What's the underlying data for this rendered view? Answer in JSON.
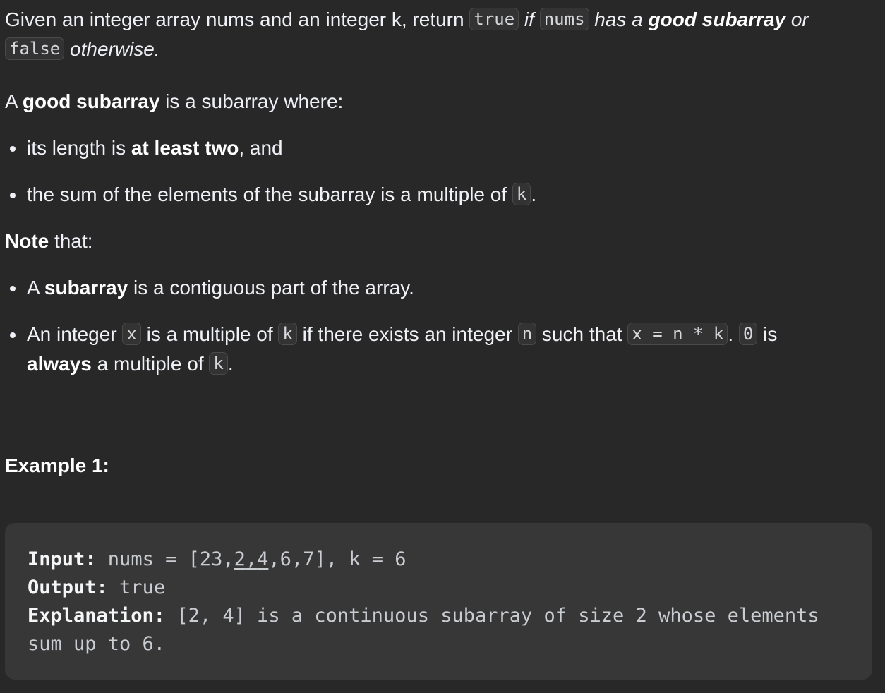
{
  "intro": {
    "t1": "Given an integer array nums and an integer k, return ",
    "code_true": "true",
    "t2": " if ",
    "code_nums": "nums",
    "t3": " has a ",
    "bold_good": "good subarray",
    "t4": " or",
    "code_false": "false",
    "t5": " otherwise."
  },
  "definition": {
    "t1": "A ",
    "bold": "good subarray",
    "t2": " is a subarray where:"
  },
  "conditions": [
    {
      "pre": "its length is ",
      "bold": "at least two",
      "post": ", and"
    },
    {
      "pre": "the sum of the elements of the subarray is a multiple of ",
      "code": "k",
      "post": "."
    }
  ],
  "note": {
    "bold": "Note",
    "rest": " that:"
  },
  "notes": {
    "n1": {
      "pre": "A ",
      "bold": "subarray",
      "post": " is a contiguous part of the array."
    },
    "n2": {
      "t1": "An integer ",
      "c1": "x",
      "t2": " is a multiple of ",
      "c2": "k",
      "t3": " if there exists an integer ",
      "c3": "n",
      "t4": " such that ",
      "c4": "x = n * k",
      "t5": ". ",
      "c5": "0",
      "t6": " is",
      "bold": "always",
      "t7": " a multiple of ",
      "c6": "k",
      "t8": "."
    }
  },
  "example": {
    "title": "Example 1:",
    "input_label": "Input:",
    "input_pre": " nums = [23,",
    "input_u1": "2",
    "input_comma": ",",
    "input_u2": "4",
    "input_post": ",6,7], k = 6",
    "output_label": "Output:",
    "output_value": " true",
    "explanation_label": "Explanation:",
    "explanation_line1": " [2, 4] is a continuous subarray of size 2 whose elements",
    "explanation_line2": "sum up to 6."
  }
}
